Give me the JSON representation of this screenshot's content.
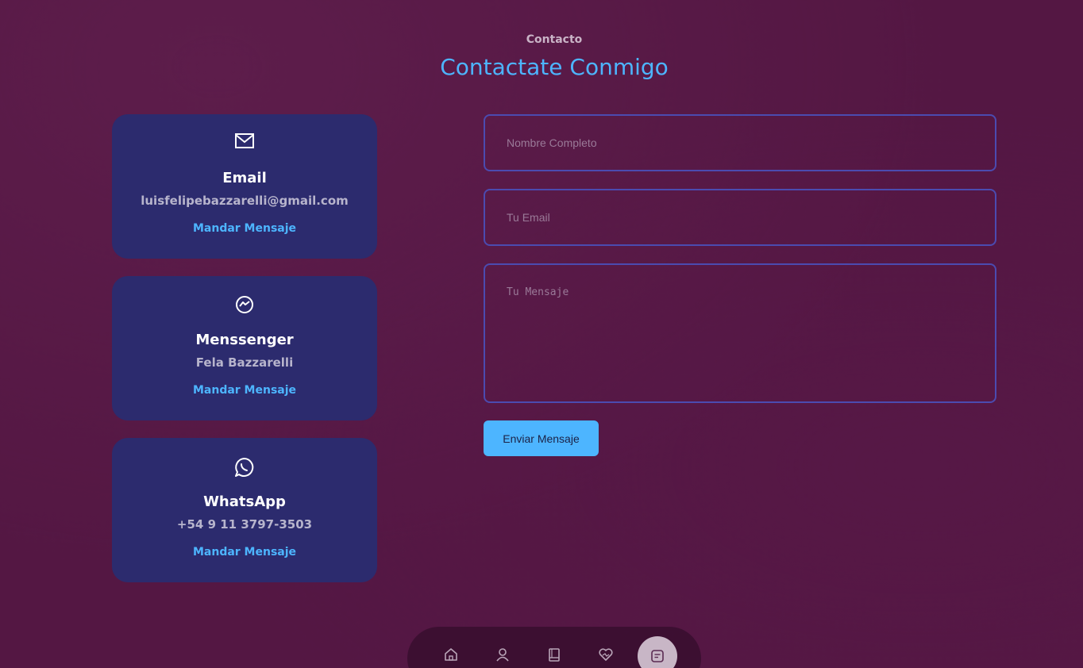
{
  "header": {
    "subtitle": "Contacto",
    "title": "Contactate Conmigo"
  },
  "cards": [
    {
      "icon": "envelope-icon",
      "title": "Email",
      "value": "luisfelipebazzarelli@gmail.com",
      "link": "Mandar Mensaje"
    },
    {
      "icon": "messenger-icon",
      "title": "Menssenger",
      "value": "Fela Bazzarelli",
      "link": "Mandar Mensaje"
    },
    {
      "icon": "whatsapp-icon",
      "title": "WhatsApp",
      "value": "+54 9 11 3797-3503",
      "link": "Mandar Mensaje"
    }
  ],
  "form": {
    "name_placeholder": "Nombre Completo",
    "name_value": "",
    "email_placeholder": "Tu Email",
    "email_value": "",
    "message_placeholder": "Tu Mensaje",
    "message_value": "",
    "submit_label": "Enviar Mensaje"
  },
  "nav": {
    "items": [
      "home-icon",
      "user-icon",
      "book-icon",
      "services-icon",
      "contact-icon"
    ],
    "active": "contact-icon"
  },
  "colors": {
    "background": "#541743",
    "card": "#2c2b6e",
    "accent": "#4db5ff",
    "field_border": "#4b4bb0"
  }
}
